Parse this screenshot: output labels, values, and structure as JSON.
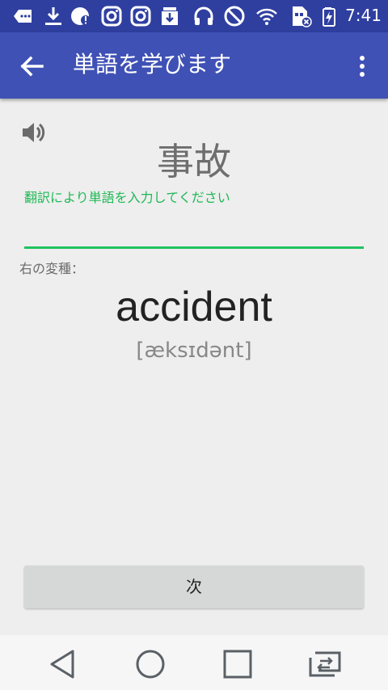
{
  "status_bar": {
    "time": "7:41",
    "icons": [
      "more-icon",
      "download-icon",
      "notification-alert-icon",
      "instagram-icon",
      "instagram-icon",
      "download-box-icon",
      "headphones-icon",
      "do-not-disturb-icon",
      "wifi-icon",
      "sim-no-signal-icon",
      "battery-charging-icon"
    ]
  },
  "app_bar": {
    "title": "単語を学びます",
    "back_icon": "arrow-back-icon",
    "menu_icon": "more-vert-icon"
  },
  "card": {
    "speaker_icon": "volume-icon",
    "word": "事故",
    "hint": "翻訳により単語を入力してください",
    "input_value": "",
    "variant_label": "右の変種：",
    "answer": "accident",
    "phonetic": "[æksɪdənt]"
  },
  "next_button": {
    "label": "次"
  },
  "nav_bar": {
    "icons": [
      "back-triangle-icon",
      "home-circle-icon",
      "recents-square-icon",
      "screen-switch-icon"
    ]
  },
  "colors": {
    "app_bar": "#3f51b5",
    "status_bar": "#2f3fa0",
    "accent_green": "#1db954",
    "background": "#eeeeee"
  }
}
